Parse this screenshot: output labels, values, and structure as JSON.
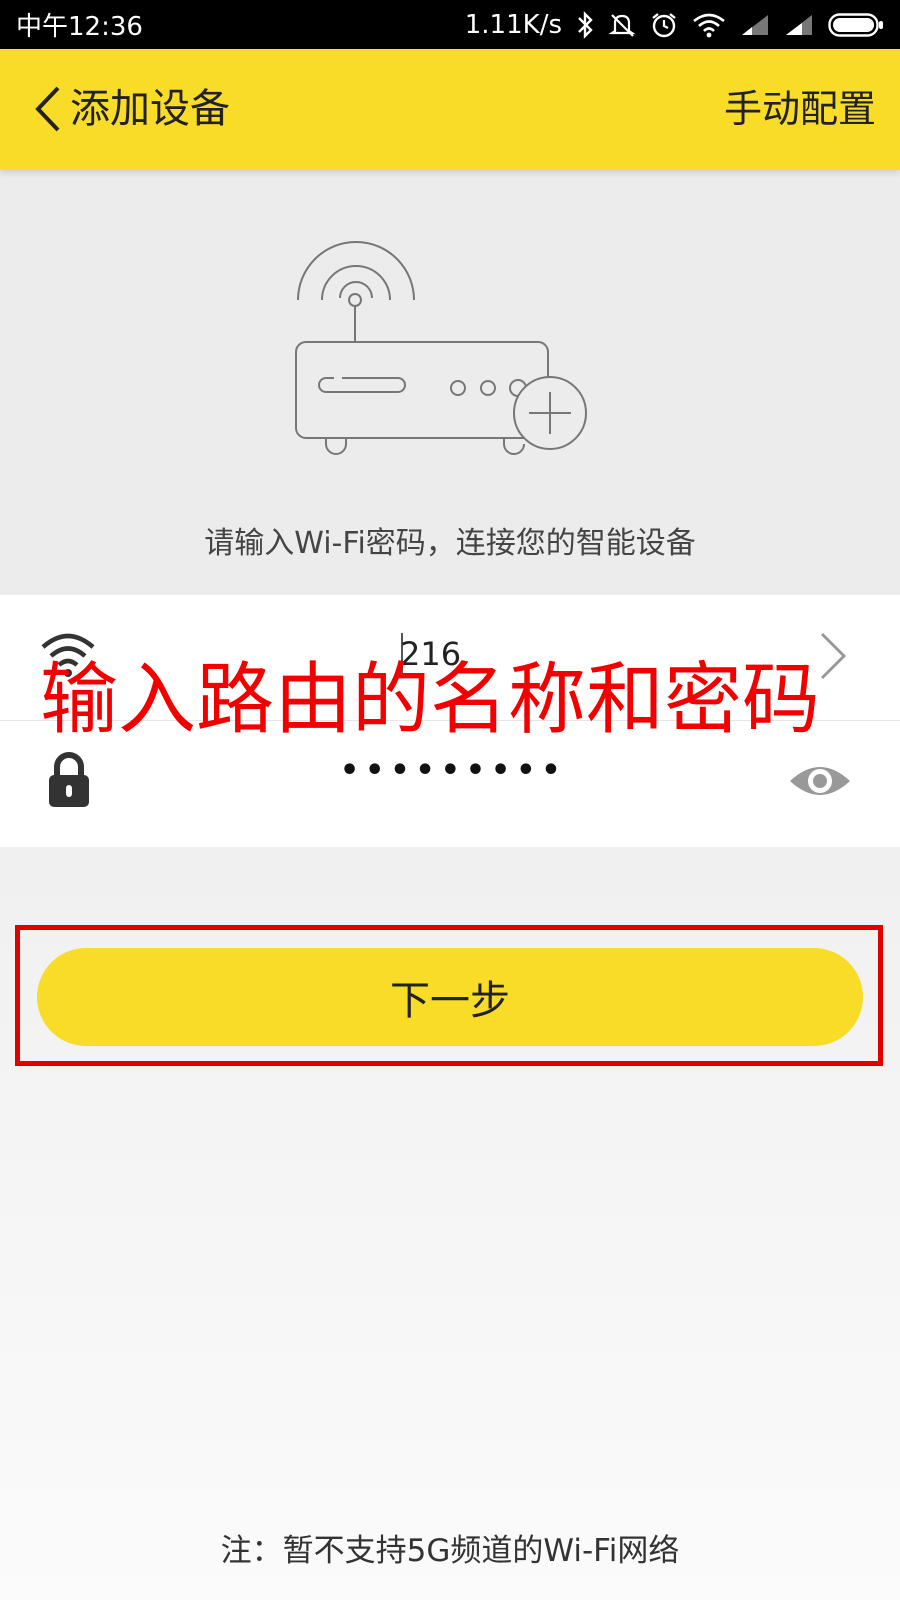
{
  "status_bar": {
    "time": "中午12:36",
    "net_speed": "1.11K/s"
  },
  "header": {
    "title": "添加设备",
    "manual_config": "手动配置"
  },
  "instruction": "请输入Wi-Fi密码，连接您的智能设备",
  "form": {
    "ssid_value": "216",
    "password_masked": "•••••••••"
  },
  "annotation": "输入路由的名称和密码",
  "next_button": "下一步",
  "footer_note": "注：暂不支持5G频道的Wi-Fi网络",
  "colors": {
    "accent": "#f8dc27",
    "annotation_red": "#f20000"
  }
}
